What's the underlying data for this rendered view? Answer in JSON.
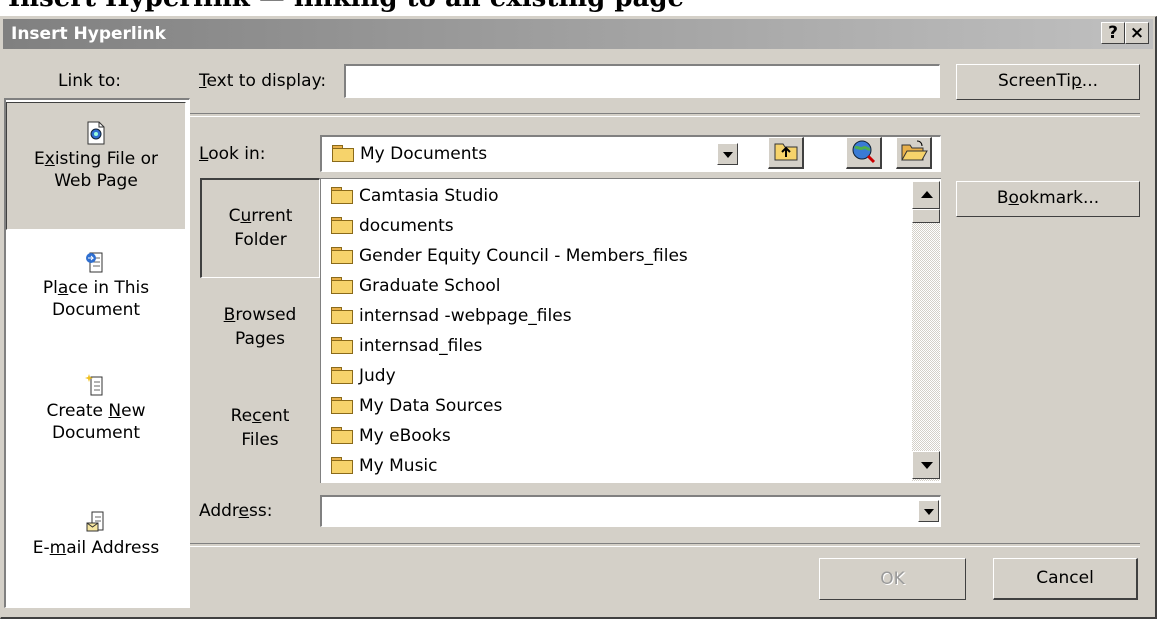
{
  "caption": "Insert Hyperlink — linking to an existing page",
  "dialog": {
    "title": "Insert Hyperlink",
    "help_label": "?",
    "close_label": "×"
  },
  "sidebar": {
    "header": "Link to:",
    "items": [
      {
        "line1_pre": "E",
        "line1_u": "x",
        "line1_post": "isting File or",
        "line2": "Web Page"
      },
      {
        "line1_pre": "Pl",
        "line1_u": "a",
        "line1_post": "ce in This",
        "line2": "Document"
      },
      {
        "line1_pre": "Create ",
        "line1_u": "N",
        "line1_post": "ew",
        "line2": "Document"
      },
      {
        "line1_pre": "E-",
        "line1_u": "m",
        "line1_post": "ail Address",
        "line2": ""
      }
    ]
  },
  "text_to_display": {
    "label_u": "T",
    "label_rest": "ext to display:",
    "value": ""
  },
  "screentip": {
    "pre": "ScreenTi",
    "u": "p",
    "post": "..."
  },
  "look_in": {
    "label_u": "L",
    "label_rest": "ook in:",
    "value": "My Documents"
  },
  "places": [
    {
      "line1_pre": "C",
      "line1_u": "u",
      "line1_post": "rrent",
      "line2": "Folder"
    },
    {
      "line1_pre": "",
      "line1_u": "B",
      "line1_post": "rowsed",
      "line2": "Pages"
    },
    {
      "line1_pre": "Re",
      "line1_u": "c",
      "line1_post": "ent",
      "line2": "Files"
    }
  ],
  "files": [
    "Camtasia Studio",
    "documents",
    "Gender Equity Council - Members_files",
    "Graduate School",
    "internsad -webpage_files",
    "internsad_files",
    "Judy",
    "My Data Sources",
    "My eBooks",
    "My Music"
  ],
  "bookmark": {
    "pre": "B",
    "u": "o",
    "post": "okmark..."
  },
  "address": {
    "label_pre": "Addr",
    "label_u": "e",
    "label_post": "ss:",
    "value": ""
  },
  "ok_label": "OK",
  "cancel_label": "Cancel"
}
